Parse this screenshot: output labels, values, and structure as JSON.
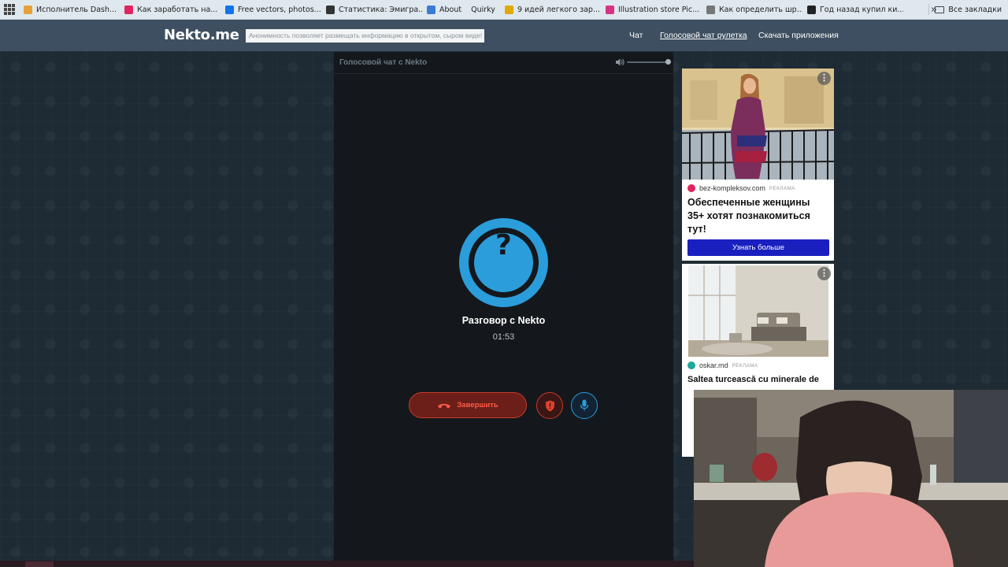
{
  "bookmarks": {
    "items": [
      {
        "label": "Исполнитель Dash...",
        "icon": "pencil-icon",
        "color": "#e8a13a"
      },
      {
        "label": "Как заработать на...",
        "icon": "s-icon",
        "color": "#e0245e"
      },
      {
        "label": "Free vectors, photos...",
        "icon": "freepik-icon",
        "color": "#1273eb"
      },
      {
        "label": "Статистика: Эмигра...",
        "icon": "globe-icon",
        "color": "#333333"
      },
      {
        "label": "About",
        "icon": "about-icon",
        "color": "#3b7bd4"
      },
      {
        "label": "Quirky",
        "icon": "",
        "color": ""
      },
      {
        "label": "9 идей легкого зар...",
        "icon": "gear-icon",
        "color": "#e0a800"
      },
      {
        "label": "Illustration store Pic...",
        "icon": "picjumbo-icon",
        "color": "#d63384"
      },
      {
        "label": "Как определить шр...",
        "icon": "f-icon",
        "color": "#777777"
      },
      {
        "label": "Год назад купил ки...",
        "icon": "plus-icon",
        "color": "#222222"
      }
    ],
    "all_label": "Все закладки"
  },
  "header": {
    "logo": "Nekto.me",
    "tagline": "Анонимность позволяет размещать информацию в открытом, сыром виде!",
    "nav": [
      "Чат",
      "Голосовой чат рулетка",
      "Скачать приложения"
    ]
  },
  "chat": {
    "panel_title": "Голосовой чат с Nekto",
    "avatar_symbol": "?",
    "conversation_title": "Разговор с Nekto",
    "timer": "01:53",
    "end_label": "Завершить",
    "volume_level": 1.0,
    "accent": "#2b9ddb",
    "danger": "#c83a2a"
  },
  "ads": [
    {
      "source": "bez-kompleksov.com",
      "tag": "РЕКЛАМА",
      "title": "Обеспеченные женщины 35+ хотят познакомиться тут!",
      "cta": "Узнать больше",
      "menu": "⋮"
    },
    {
      "source": "oskar.md",
      "tag": "РЕКЛАМА",
      "title": "Saltea turcească cu minerale de",
      "menu": "⋮"
    }
  ]
}
